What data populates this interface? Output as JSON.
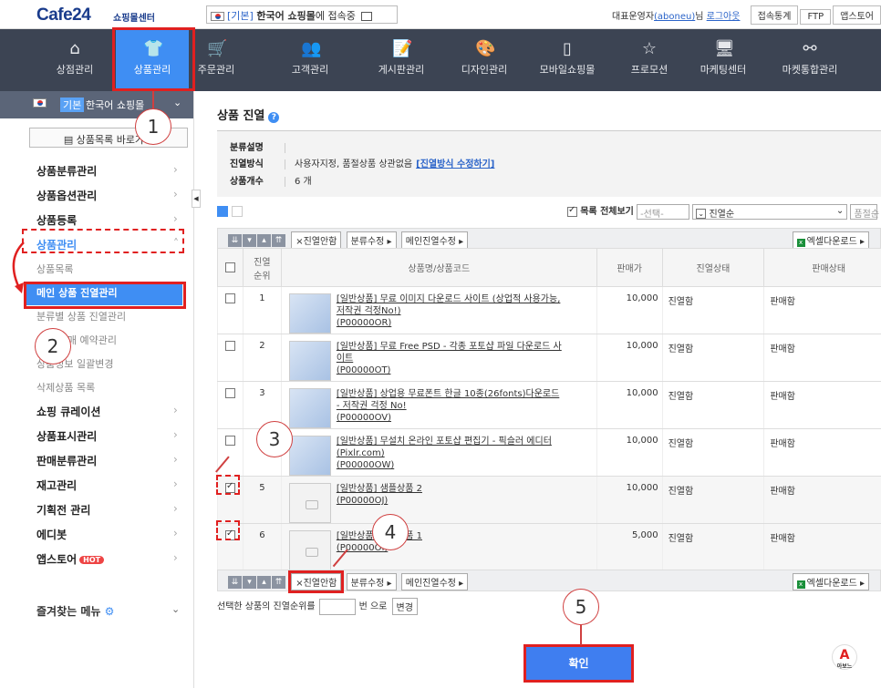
{
  "topbar": {
    "logo": "Cafe24",
    "logo_sub": "쇼핑몰센터",
    "shop_basic": "[기본]",
    "shop_name": "한국어 쇼핑몰",
    "shop_suffix": "에 접속중",
    "admin": "대표운영자",
    "admin_id": "(aboneu)",
    "admin_suffix": "님",
    "logout": "로그아웃",
    "stats": "접속통계",
    "ftp": "FTP",
    "appstore": "앱스토어"
  },
  "gnb": [
    {
      "label": "상점관리",
      "icon": "home-icon"
    },
    {
      "label": "상품관리",
      "icon": "shirt-icon"
    },
    {
      "label": "주문관리",
      "icon": "cart-icon"
    },
    {
      "label": "고객관리",
      "icon": "users-icon"
    },
    {
      "label": "게시판관리",
      "icon": "board-icon"
    },
    {
      "label": "디자인관리",
      "icon": "palette-icon"
    },
    {
      "label": "모바일쇼핑몰",
      "icon": "mobile-icon"
    },
    {
      "label": "프로모션",
      "icon": "star-icon"
    },
    {
      "label": "마케팅센터",
      "icon": "monitor-icon"
    },
    {
      "label": "마켓통합관리",
      "icon": "network-icon"
    }
  ],
  "sidebar": {
    "shop_basic": "기본",
    "shop_name": "한국어 쇼핑몰",
    "list_button": "상품목록 바로가기",
    "menu": [
      {
        "label": "상품분류관리"
      },
      {
        "label": "상품옵션관리"
      },
      {
        "label": "상품등록"
      }
    ],
    "open_menu": "상품관리",
    "submenu": [
      "상품목록",
      "메인 상품 진열관리",
      "분류별 상품 진열관리",
      "상품 판매 예약관리",
      "상품정보 일괄변경",
      "삭제상품 목록"
    ],
    "menu2": [
      "쇼핑 큐레이션",
      "상품표시관리",
      "판매분류관리",
      "재고관리",
      "기획전 관리",
      "에디봇",
      "앱스토어"
    ],
    "hot": "HOT",
    "favorites": "즐겨찾는 메뉴"
  },
  "main": {
    "title": "상품 진열",
    "info": {
      "k1": "분류설명",
      "v1": "",
      "k2": "진열방식",
      "v2": "사용자지정, 품절상품 상관없음",
      "v2_link": "[진열방식 수정하기]",
      "k3": "상품개수",
      "v3": "6 개"
    },
    "list_all": "목록 전체보기",
    "select_placeholder": "-선택-",
    "sort": "진열순",
    "sort2": "품절순",
    "toolbar": {
      "unlist": "×진열안함",
      "cat_edit": "분류수정",
      "main_edit": "메인진열수정",
      "excel": "엑셀다운로드"
    },
    "columns": [
      "진열\n순위",
      "상품명/상품코드",
      "판매가",
      "진열상태",
      "판매상태"
    ],
    "rows": [
      {
        "rank": "1",
        "name": "[일반상품] 무료 이미지 다운로드 사이트 (상업적 사용가능,저작권 걱정No!)",
        "code": "(P00000OR)",
        "price": "10,000",
        "display": "진열함",
        "sale": "판매함",
        "checked": false,
        "thumb": true
      },
      {
        "rank": "2",
        "name": "[일반상품] 무료 Free PSD - 각종 포토샵 파일 다운로드 사이트",
        "code": "(P00000OT)",
        "price": "10,000",
        "display": "진열함",
        "sale": "판매함",
        "checked": false,
        "thumb": true
      },
      {
        "rank": "3",
        "name": "[일반상품] 상업용 무료폰트 한글 10종(26fonts)다운로드 - 저작권 걱정 No!",
        "code": "(P00000OV)",
        "price": "10,000",
        "display": "진열함",
        "sale": "판매함",
        "checked": false,
        "thumb": true
      },
      {
        "rank": "4",
        "name": "[일반상품] 무설치 온라인 포토샵 편집기 - 픽슬러 에디터(Pixlr.com)",
        "code": "(P00000OW)",
        "price": "10,000",
        "display": "진열함",
        "sale": "판매함",
        "checked": false,
        "thumb": true
      },
      {
        "rank": "5",
        "name": "[일반상품] 샘플상품 2",
        "code": "(P00000OJ)",
        "price": "10,000",
        "display": "진열함",
        "sale": "판매함",
        "checked": true,
        "thumb": false
      },
      {
        "rank": "6",
        "name": "[일반상품] 샘플상품 1",
        "code": "(P00000OI)",
        "price": "5,000",
        "display": "진열함",
        "sale": "판매함",
        "checked": true,
        "thumb": false
      }
    ],
    "footer_label": "선택한 상품의 진열순위를",
    "footer_unit": "번 으로",
    "footer_btn": "변경",
    "confirm": "확인"
  },
  "markers": [
    "1",
    "2",
    "3",
    "4",
    "5"
  ],
  "logo_small": "아보느"
}
